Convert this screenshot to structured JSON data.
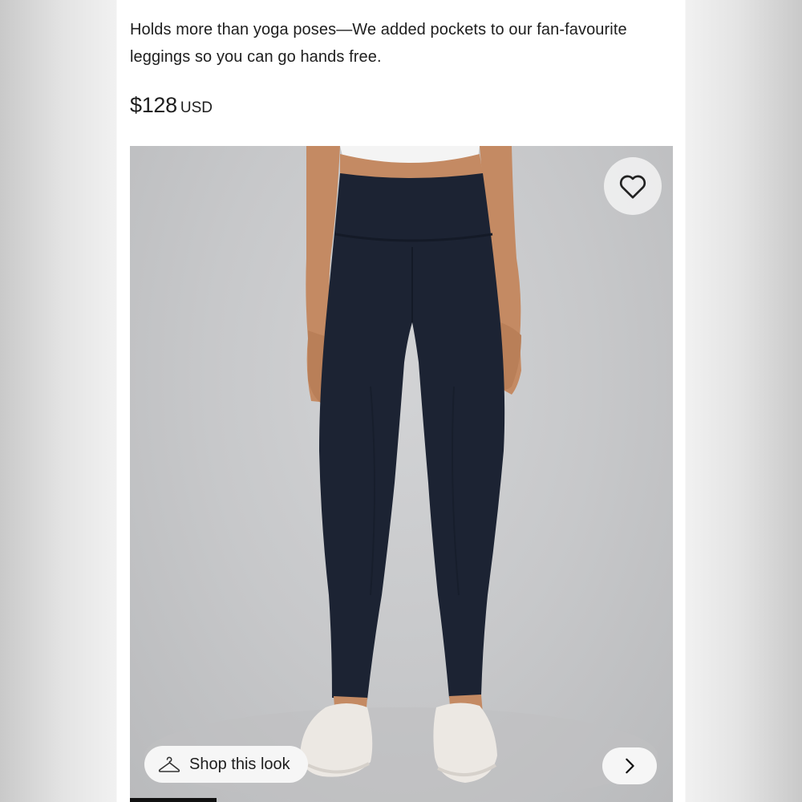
{
  "product": {
    "description": "Holds more than yoga poses—We added pockets to our fan-favourite leggings so you can go hands free.",
    "price": "$128",
    "currency": "USD"
  },
  "gallery": {
    "shop_label": "Shop this look",
    "shop_icon": "hanger-icon",
    "favorite_icon": "heart-icon",
    "next_icon": "chevron-right-icon",
    "progress_fraction": 0.16
  },
  "colors": {
    "leggings": "#1c2333",
    "background": "#c9cacc",
    "text": "#1e1e1e"
  }
}
